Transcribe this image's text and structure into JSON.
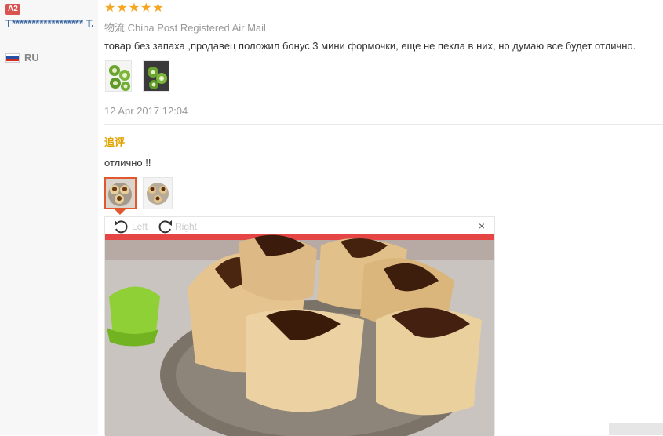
{
  "reviewer": {
    "level_badge": "A2",
    "name": "T****************** T.",
    "country_code": "RU",
    "flag_colors": [
      "#ffffff",
      "#2451a6",
      "#d52b1e"
    ]
  },
  "review": {
    "rating": 5,
    "star_glyph": "★",
    "shipping": "物流 China Post Registered Air Mail",
    "text": "товар без запаха ,продавец положил бонус 3 мини формочки, еще не пекла в них, но думаю все будет отлично.",
    "date": "12 Apr 2017 12:04",
    "photos": [
      "kiwi-slices-photo-1",
      "kiwi-slices-photo-2"
    ]
  },
  "followup": {
    "title": "追评",
    "text": "отлично !!",
    "photos": [
      "heart-cupcakes-photo-1",
      "heart-cupcakes-photo-2"
    ]
  },
  "viewer": {
    "rotate_left_label": "Left",
    "rotate_right_label": "Right",
    "close_glyph": "×"
  },
  "colors": {
    "star": "#f5a623",
    "username": "#3a66a3",
    "followup_title": "#e0a300",
    "active_thumb_border": "#e0592e"
  }
}
